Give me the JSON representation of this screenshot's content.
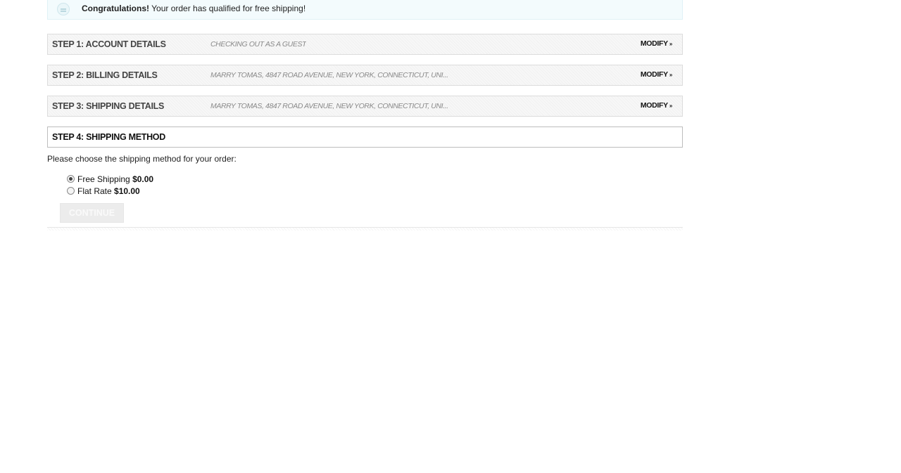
{
  "notice": {
    "icon": "info-icon",
    "bold": "Congratulations!",
    "text": " Your order has qualified for free shipping!"
  },
  "steps": [
    {
      "title": "Step 1: Account Details",
      "summary": "Checking out as a guest",
      "modify": "Modify",
      "modify_arrow": "»"
    },
    {
      "title": "Step 2: Billing Details",
      "summary": "Marry Tomas, 4847 Road Avenue, New York, Connecticut, Uni...",
      "modify": "Modify",
      "modify_arrow": "»"
    },
    {
      "title": "Step 3: Shipping Details",
      "summary": "Marry Tomas, 4847 Road Avenue, New York, Connecticut, Uni...",
      "modify": "Modify",
      "modify_arrow": "»"
    },
    {
      "title": "Step 4: Shipping Method"
    }
  ],
  "shipping": {
    "intro": "Please choose the shipping method for your order:",
    "options": [
      {
        "label": "Free Shipping",
        "price": "$0.00",
        "selected": true
      },
      {
        "label": "Flat Rate",
        "price": "$10.00",
        "selected": false
      }
    ],
    "continue_label": "Continue"
  }
}
